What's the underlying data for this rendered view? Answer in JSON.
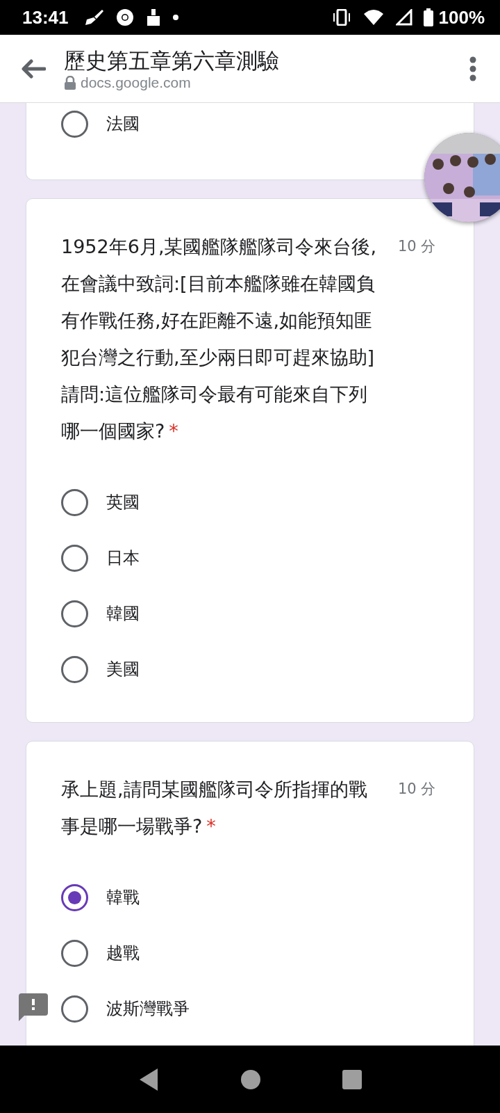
{
  "status_bar": {
    "time": "13:41",
    "battery": "100%"
  },
  "header": {
    "title": "歷史第五章第六章測驗",
    "url": "docs.google.com"
  },
  "cards": [
    {
      "options": [
        {
          "label": "法國",
          "selected": false
        }
      ]
    },
    {
      "question": "1952年6月,某國艦隊艦隊司令來台後,在會議中致詞:[目前本艦隊雖在韓國負有作戰任務,好在距離不遠,如能預知匪犯台灣之行動,至少兩日即可趕來協助]請問:這位艦隊司令最有可能來自下列哪一個國家?",
      "required_mark": "*",
      "points": "10 分",
      "options": [
        {
          "label": "英國",
          "selected": false
        },
        {
          "label": "日本",
          "selected": false
        },
        {
          "label": "韓國",
          "selected": false
        },
        {
          "label": "美國",
          "selected": false
        }
      ]
    },
    {
      "question": "承上題,請問某國艦隊司令所指揮的戰事是哪一場戰爭?",
      "required_mark": "*",
      "points": "10 分",
      "options": [
        {
          "label": "韓戰",
          "selected": true
        },
        {
          "label": "越戰",
          "selected": false
        },
        {
          "label": "波斯灣戰爭",
          "selected": false
        }
      ]
    }
  ]
}
